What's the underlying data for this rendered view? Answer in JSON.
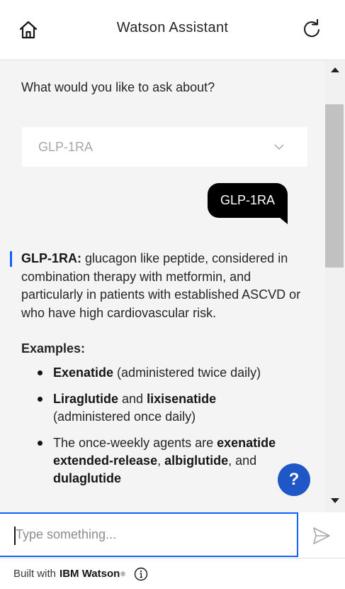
{
  "header": {
    "title": "Watson Assistant"
  },
  "chat": {
    "prompt": "What would you like to ask about?",
    "dropdown": {
      "selected": "GLP-1RA"
    },
    "user_message": "GLP-1RA",
    "bot": {
      "term": "GLP-1RA:",
      "definition": " glucagon like peptide, considered in combination therapy with metformin, and particularly in patients with established ASCVD or who have high cardiovascular risk.",
      "examples_title": "Examples:",
      "examples": [
        {
          "bold": "Exenatide",
          "rest": " (administered twice daily)"
        },
        {
          "bold": "Liraglutide",
          "mid": " and ",
          "bold2": "lixisenatide",
          "rest": " (administered once daily)"
        },
        {
          "pre": "The once-weekly agents are ",
          "bold": "exenatide extended-release",
          "mid": ", ",
          "bold2": "albiglutide",
          "mid2": ", and ",
          "bold3": "dulaglutide"
        }
      ]
    },
    "help_label": "?"
  },
  "input": {
    "placeholder": "Type something..."
  },
  "footer": {
    "prefix": "Built with",
    "brand": "IBM Watson",
    "reg": "®"
  },
  "colors": {
    "accent": "#0f62fe",
    "help": "#1f57c7",
    "bubble": "#000000",
    "chat_bg": "#f4f4f4"
  }
}
